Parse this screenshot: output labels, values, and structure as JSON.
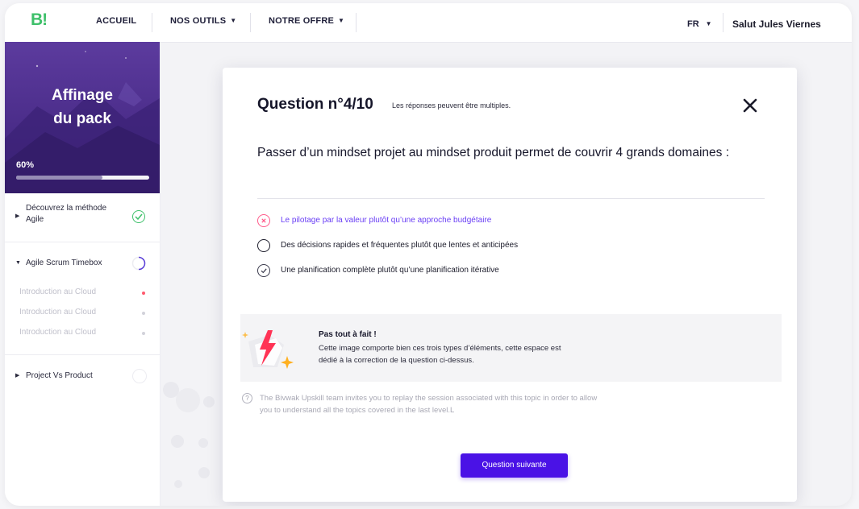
{
  "header": {
    "logo_text": "B!",
    "nav": [
      {
        "label": "ACCUEIL"
      },
      {
        "label": "NOS OUTILS"
      },
      {
        "label": "NOTRE OFFRE"
      }
    ],
    "language": "FR",
    "greeting": "Salut Jules Viernes"
  },
  "sidebar": {
    "hero_title_line1": "Affinage",
    "hero_title_line2": "du pack",
    "progress_label": "60%",
    "progress_value": 0.65,
    "sections": [
      {
        "label_line1": "Découvrez la méthode",
        "label_line2": "Agile",
        "status": "completed"
      },
      {
        "label": "Agile Scrum Timebox",
        "status": "in-progress",
        "children": [
          {
            "label": "Introduction au Cloud",
            "dot_color": "#ff5a6e"
          },
          {
            "label": "Introduction au Cloud",
            "dot_color": "#d2d2da"
          },
          {
            "label": "Introduction au Cloud",
            "dot_color": "#d2d2da"
          }
        ]
      },
      {
        "label": "Project Vs Product",
        "status": "not-started"
      }
    ]
  },
  "modal": {
    "title": "Question n°4/10",
    "hint": "Les réponses peuvent être multiples.",
    "question": "Passer d’un mindset projet au mindset produit permet de couvrir 4 grands domaines :",
    "answers": [
      {
        "text": "Le pilotage par la valeur plutôt qu’une approche budgétaire",
        "state": "wrong",
        "color": "#6a3ff5"
      },
      {
        "text": "Des décisions rapides et fréquentes plutôt que lentes et anticipées",
        "state": "neutral",
        "color": "#1c1c2b"
      },
      {
        "text": "Une planification complète plutôt qu’une planification itérative",
        "state": "correct",
        "color": "#1c1c2b"
      }
    ],
    "feedback": {
      "title": "Pas tout à fait !",
      "body": "Cette image comporte bien ces trois types d’éléments, cette espace est dédié à la correction de la  question ci-dessus."
    },
    "info_icon": "?",
    "info": "The Bivwak Upskill team invites you to replay the session associated with this topic in order to allow you to understand all the topics covered in the last level.L",
    "next_button": "Question suivante"
  },
  "colors": {
    "accent": "#4a12e6",
    "success": "#3ec06a",
    "error": "#ff5a8a",
    "hero": "#4b2d8a"
  }
}
